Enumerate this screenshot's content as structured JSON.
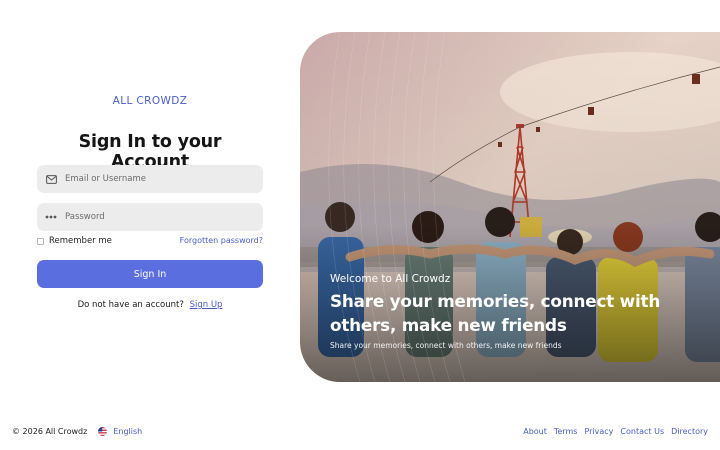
{
  "brand": "ALL CROWDZ",
  "form": {
    "title": "Sign In to your Account",
    "email_placeholder": "Email or Username",
    "password_placeholder": "Password",
    "remember_label": "Remember me",
    "forgot_label": "Forgotten password?",
    "submit_label": "Sign In",
    "signup_prompt": "Do not have an account?",
    "signup_link": "Sign Up"
  },
  "hero": {
    "welcome": "Welcome to All Crowdz",
    "headline": "Share your memories, connect with others, make new friends",
    "subline": "Share your memories, connect with others, make new friends"
  },
  "footer": {
    "copyright": "© 2026 All Crowdz",
    "language": "English",
    "links": [
      "About",
      "Terms",
      "Privacy",
      "Contact Us",
      "Directory"
    ]
  },
  "colors": {
    "accent": "#5b6ee0",
    "link": "#4a5dc4",
    "field_bg": "#ececec"
  },
  "icons": {
    "email": "envelope-icon",
    "password": "dots-icon",
    "language": "us-flag-icon"
  }
}
